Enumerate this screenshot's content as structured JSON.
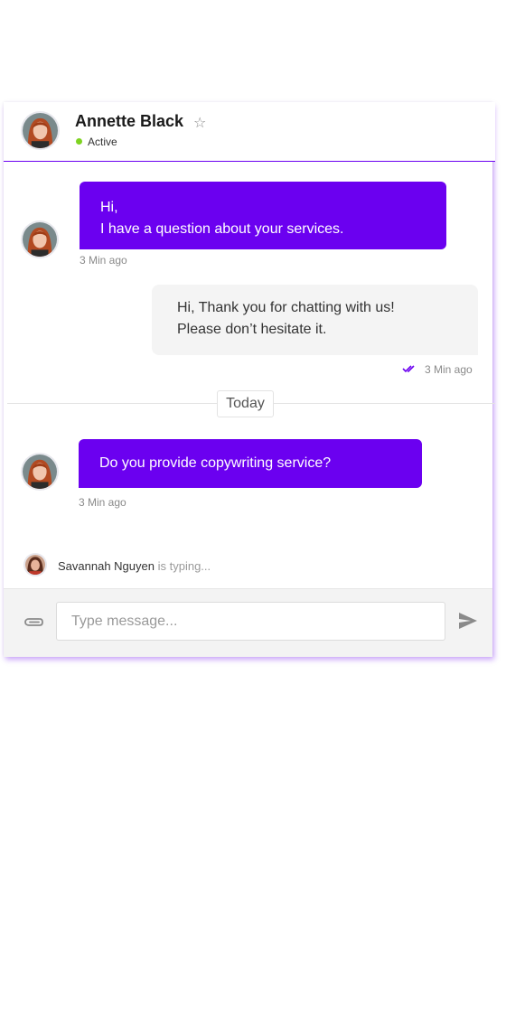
{
  "contact": {
    "name": "Annette Black",
    "star_icon": "star-outline-icon",
    "status": "Active",
    "status_color": "#7ed321"
  },
  "messages": [
    {
      "direction": "incoming",
      "lines": [
        "Hi,",
        "I have a question about your services."
      ],
      "time": "3 Min ago"
    },
    {
      "direction": "outgoing",
      "lines": [
        "Hi, Thank you for chatting with us!",
        "Please don’t hesitate it."
      ],
      "time": "3 Min ago",
      "read_icon": "double-check-icon"
    },
    {
      "direction": "incoming",
      "lines": [
        "Do you provide copywriting service?"
      ],
      "time": "3 Min ago"
    }
  ],
  "separator": {
    "label": "Today"
  },
  "typing": {
    "name": "Savannah Nguyen",
    "text": "is typing..."
  },
  "composer": {
    "placeholder": "Type message...",
    "attach_icon": "paperclip-icon",
    "send_icon": "send-icon"
  },
  "colors": {
    "accent": "#6b00f0",
    "outgoing_bubble": "#f4f4f4",
    "muted": "#8a8a8a"
  }
}
